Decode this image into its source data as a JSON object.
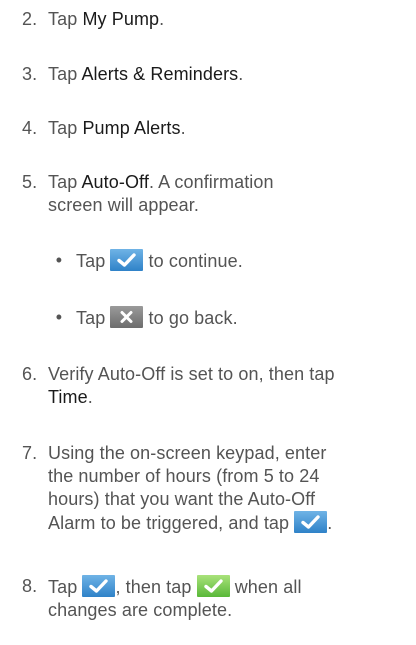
{
  "steps": [
    {
      "num": "2.",
      "pre": "Tap ",
      "bold": "My Pump",
      "post": "."
    },
    {
      "num": "3.",
      "pre": "Tap ",
      "bold": "Alerts & Reminders",
      "post": "."
    },
    {
      "num": "4.",
      "pre": "Tap ",
      "bold": "Pump Alerts",
      "post": "."
    },
    {
      "num": "5.",
      "pre": "Tap ",
      "bold": "Auto-Off",
      "post": ". A confirmation",
      "line2": "screen will appear."
    },
    {
      "num": "6.",
      "line1": "Verify Auto-Off is set to on, then tap",
      "bold2": "Time",
      "post2": "."
    },
    {
      "num": "7.",
      "line1": "Using the on-screen keypad, enter",
      "line2": "the number of hours (from 5 to 24",
      "line3": "hours) that you want the Auto-Off",
      "line4_pre": "Alarm to be triggered, and tap ",
      "line4_post": "."
    },
    {
      "num": "8.",
      "pre": "Tap ",
      "mid": ", then tap ",
      "post": " when all",
      "line2": "changes are complete."
    }
  ],
  "bullets": [
    {
      "dot": "•",
      "pre": "Tap ",
      "post": " to continue."
    },
    {
      "dot": "•",
      "pre": "Tap ",
      "post": " to go back."
    }
  ],
  "icons": {
    "confirm_blue": {
      "name": "checkmark-icon",
      "color": "#2f82c8"
    },
    "cancel_gray": {
      "name": "close-icon",
      "color": "#6d6d6d"
    },
    "confirm_green": {
      "name": "checkmark-icon",
      "color": "#59b838"
    }
  }
}
